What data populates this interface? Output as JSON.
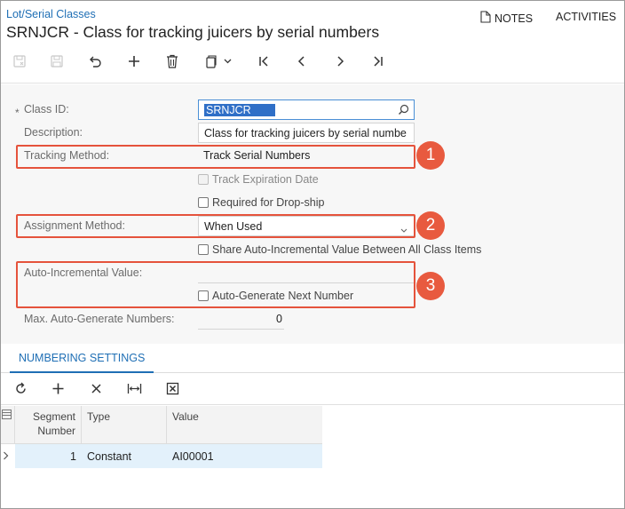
{
  "header": {
    "breadcrumb": "Lot/Serial Classes",
    "title": "SRNJCR - Class for tracking juicers by serial numbers",
    "notes_label": "NOTES",
    "activities_label": "ACTIVITIES"
  },
  "form": {
    "class_id_label": "Class ID:",
    "class_id_value": "SRNJCR",
    "description_label": "Description:",
    "description_value": "Class for tracking juicers by serial numbe",
    "tracking_method_label": "Tracking Method:",
    "tracking_method_value": "Track Serial Numbers",
    "track_expiration_label": "Track Expiration Date",
    "required_dropship_label": "Required for Drop-ship",
    "assignment_method_label": "Assignment Method:",
    "assignment_method_value": "When Used",
    "share_auto_label": "Share Auto-Incremental Value Between All Class Items",
    "auto_incremental_label": "Auto-Incremental Value:",
    "auto_generate_label": "Auto-Generate Next Number",
    "max_auto_label": "Max. Auto-Generate Numbers:",
    "max_auto_value": "0"
  },
  "callouts": [
    "1",
    "2",
    "3"
  ],
  "tabs": {
    "active": "NUMBERING SETTINGS"
  },
  "grid": {
    "columns": [
      "Segment Number",
      "Type",
      "Value"
    ],
    "column_lines": {
      "segment_line1": "Segment",
      "segment_line2": "Number"
    },
    "rows": [
      {
        "segment": "1",
        "type": "Constant",
        "value": "AI00001"
      }
    ]
  },
  "colors": {
    "accent": "#1f6fb5",
    "callout": "#e85a3f",
    "selected_row": "#e3f1fb",
    "selection_highlight": "#2f6fc7"
  }
}
